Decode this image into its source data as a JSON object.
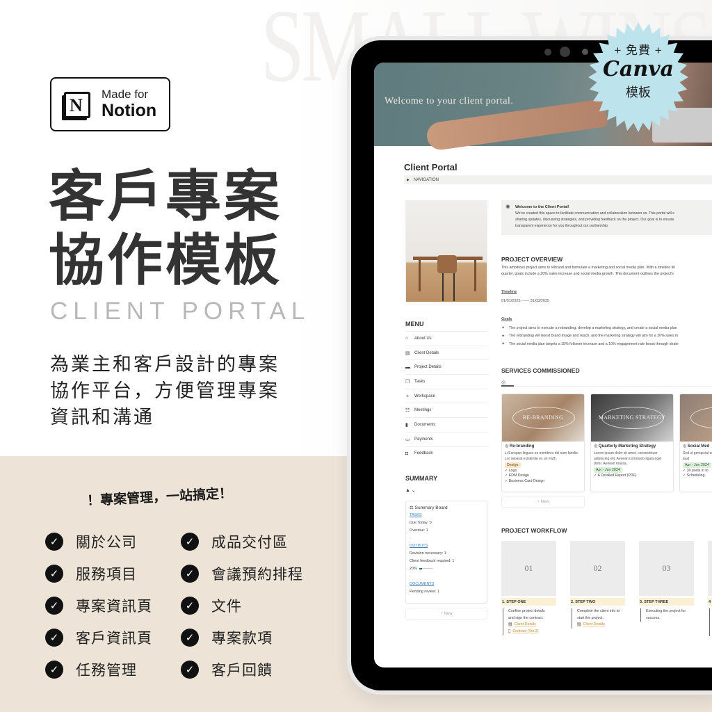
{
  "badge": {
    "line1": "Made for",
    "line2": "Notion",
    "logo_letter": "N"
  },
  "watermark": "SMALL WINS",
  "hero": {
    "title_line1": "客戶專案",
    "title_line2": "協作模板",
    "title_en": "CLIENT PORTAL",
    "subtitle_line1": "為業主和客戶設計的專案",
    "subtitle_line2": "協作平台，方便管理專案",
    "subtitle_line3": "資訊和溝通"
  },
  "tagline": "！專案管理，一站搞定！",
  "features": [
    "關於公司",
    "成品交付區",
    "服務項目",
    "會議預約排程",
    "專案資訊頁",
    "文件",
    "客戶資訊頁",
    "專案款項",
    "任務管理",
    "客戶回饋"
  ],
  "canva_badge": {
    "line1": "+ 免費 +",
    "line2": "Canva",
    "line3": "模板",
    "color": "#bde3ec"
  },
  "portal": {
    "cover_text": "Welcome to your client portal.",
    "title": "Client Portal",
    "nav_toggle": "NAVIGATION",
    "menu": {
      "heading": "MENU",
      "items": [
        {
          "icon": "⌂",
          "label": "About Us"
        },
        {
          "icon": "▤",
          "label": "Client Details"
        },
        {
          "icon": "▬",
          "label": "Project Details"
        },
        {
          "icon": "❐",
          "label": "Tasks"
        },
        {
          "icon": "✧",
          "label": "Workspace"
        },
        {
          "icon": "☷",
          "label": "Meetings"
        },
        {
          "icon": "▮",
          "label": "Documents"
        },
        {
          "icon": "▭",
          "label": "Payments"
        },
        {
          "icon": "◘",
          "label": "Feedback"
        }
      ]
    },
    "summary": {
      "heading": "SUMMARY",
      "view_icon": "▲ ⌄",
      "board_title": "Summary Board",
      "tasks_label": "TASKS",
      "due_today": "Due Today: 0",
      "overdue": "Overdue: 1",
      "outputs_label": "OUTPUTS",
      "revision": "Revision necessary: 1",
      "client_feedback": "Client feedback required: 1",
      "progress_text": "20%",
      "progress_value": 0.2,
      "documents_label": "DOCUMENTS",
      "pending_review": "Pending review: 1",
      "dot": "·",
      "new_label": "+ New"
    },
    "callout": {
      "title": "Welcome to the Client Portal!",
      "line1": "We've created this space to facilitate communication and collaboration between us. This portal will s",
      "line2": "sharing updates, discussing strategies, and providing feedback on the project. Our goal is to ensure",
      "line3": "transparent experience for you throughout our partnership."
    },
    "overview": {
      "heading": "PROJECT OVERVIEW",
      "line1": "This ambitious project aims to rebrand and formulate a marketing and social media plan. With a timeline till",
      "line2": "quarter, goals include a 20% sales increase and social media growth. This document outlines the project's",
      "timeline_label": "Timeline",
      "timeline_value": "01/01/2025 —— 31/03/2025",
      "goals_label": "Goals",
      "goals": [
        "The project aims to execute a rebranding, develop a marketing strategy, and create a social media plan",
        "The rebranding will boost brand image and reach, and the marketing strategy will aim for a 20% sales in",
        "The social media plan targets a 15% follower increase and a 10% engagement rate boost through strate"
      ]
    },
    "services": {
      "heading": "SERVICES COMMISSIONED",
      "view_icon": "◎",
      "new_label": "+ New",
      "cards": [
        {
          "image_text": "RE-BRANDING",
          "title": "Re-branding",
          "desc": "Li Europan lingues es membres del sam familie. Lor separat existentie es un myth.",
          "tag": "Design",
          "deliverables": [
            "✓ Logo",
            "✓ EDM Design",
            "✓ Business Card Design"
          ]
        },
        {
          "image_text": "MARKETING STRATEGY",
          "title": "Quarterly Marketing Strategy",
          "desc": "Lorem ipsum dolor sit amet, consectetuer adipiscing elit. Aenean commodo ligula eget dolor. Aenean massa.",
          "tag": "Apr - Jun 2024",
          "deliverables": [
            "✓ A Detailed Report (PDF)"
          ]
        },
        {
          "image_text": "SOC",
          "title": "Social Med",
          "desc": "Sed ut perspiciat error sit voluptat doloremque laud",
          "tag": "Apr - Jun 2024",
          "deliverables": [
            "✓ 30 posts in to",
            "✓ Scheduling"
          ]
        }
      ]
    },
    "workflow": {
      "heading": "PROJECT WORKFLOW",
      "steps": [
        {
          "num": "01",
          "label": "1. STEP ONE",
          "desc": "Confirm project details and sign the contract.",
          "links": [
            "Client Details",
            "Contract (Ver.2)"
          ]
        },
        {
          "num": "02",
          "label": "2. STEP TWO",
          "desc": "Complete the client info to start the project.",
          "links": [
            "Client Details"
          ]
        },
        {
          "num": "03",
          "label": "3. STEP THREE",
          "desc": "Executing the project for success.",
          "links": []
        },
        {
          "num": "",
          "label": "4",
          "desc": "",
          "links": []
        }
      ]
    }
  }
}
